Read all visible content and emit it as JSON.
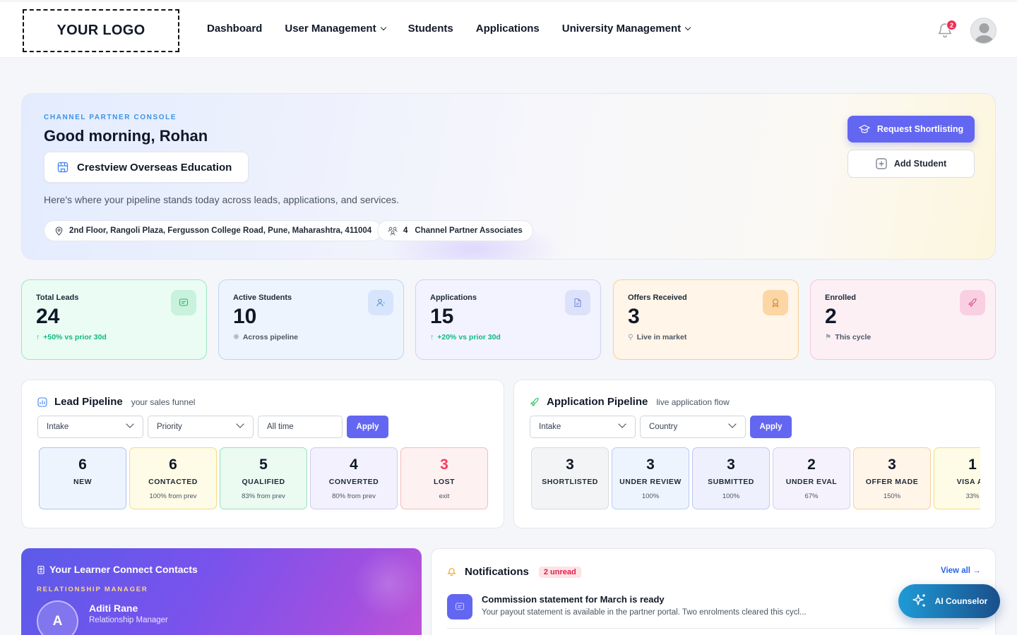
{
  "nav": {
    "logo": "YOUR LOGO",
    "links": [
      "Dashboard",
      "User Management",
      "Students",
      "Applications",
      "University Management"
    ],
    "notification_count": "2"
  },
  "hero": {
    "eyebrow": "CHANNEL PARTNER CONSOLE",
    "greeting": "Good morning, Rohan",
    "org_name": "Crestview Overseas Education",
    "subtitle": "Here's where your pipeline stands today across leads, applications, and services.",
    "address": "2nd Floor, Rangoli Plaza, Fergusson College Road, Pune, Maharashtra, 411004",
    "associates_count": "4",
    "associates_label": "Channel Partner Associates",
    "primary_button": "Request Shortlisting",
    "secondary_button": "Add Student"
  },
  "stats": [
    {
      "label": "Total Leads",
      "value": "24",
      "foot": "+50% vs prior 30d",
      "icon": "message-icon"
    },
    {
      "label": "Active Students",
      "value": "10",
      "foot": "Across pipeline",
      "icon": "user-icon"
    },
    {
      "label": "Applications",
      "value": "15",
      "foot": "+20% vs prior 30d",
      "icon": "file-icon"
    },
    {
      "label": "Offers Received",
      "value": "3",
      "foot": "Live in market",
      "icon": "award-icon"
    },
    {
      "label": "Enrolled",
      "value": "2",
      "foot": "This cycle",
      "icon": "rocket-icon"
    }
  ],
  "lead_pipeline": {
    "title": "Lead Pipeline",
    "subtitle": "your sales funnel",
    "filters": {
      "intake": "Intake",
      "priority": "Priority",
      "date": "All time",
      "apply": "Apply"
    },
    "stages": [
      {
        "count": "6",
        "label": "NEW",
        "sub": ""
      },
      {
        "count": "6",
        "label": "CONTACTED",
        "sub": "100% from prev"
      },
      {
        "count": "5",
        "label": "QUALIFIED",
        "sub": "83% from prev"
      },
      {
        "count": "4",
        "label": "CONVERTED",
        "sub": "80% from prev"
      },
      {
        "count": "3",
        "label": "LOST",
        "sub": "exit"
      }
    ]
  },
  "application_pipeline": {
    "title": "Application Pipeline",
    "subtitle": "live application flow",
    "filters": {
      "intake": "Intake",
      "country": "Country",
      "apply": "Apply"
    },
    "stages": [
      {
        "count": "3",
        "label": "SHORTLISTED",
        "sub": ""
      },
      {
        "count": "3",
        "label": "UNDER REVIEW",
        "sub": "100%"
      },
      {
        "count": "3",
        "label": "SUBMITTED",
        "sub": "100%"
      },
      {
        "count": "2",
        "label": "UNDER EVAL",
        "sub": "67%"
      },
      {
        "count": "3",
        "label": "OFFER MADE",
        "sub": "150%"
      },
      {
        "count": "1",
        "label": "VISA AP",
        "sub": "33%"
      }
    ]
  },
  "contacts": {
    "title": "Your Learner Connect Contacts",
    "section": "RELATIONSHIP MANAGER",
    "initial": "A",
    "name": "Aditi Rane",
    "role": "Relationship Manager"
  },
  "notifications": {
    "title": "Notifications",
    "unread": "2 unread",
    "view_all": "View all →",
    "items": [
      {
        "title": "Commission statement for March is ready",
        "body": "Your payout statement is available in the partner portal. Two enrolments cleared this cycl..."
      }
    ]
  },
  "ai_button": "AI Counselor",
  "colors": {
    "accent": "#6366f1",
    "positive": "#10b981",
    "danger": "#ef2f55",
    "link": "#2563eb"
  }
}
